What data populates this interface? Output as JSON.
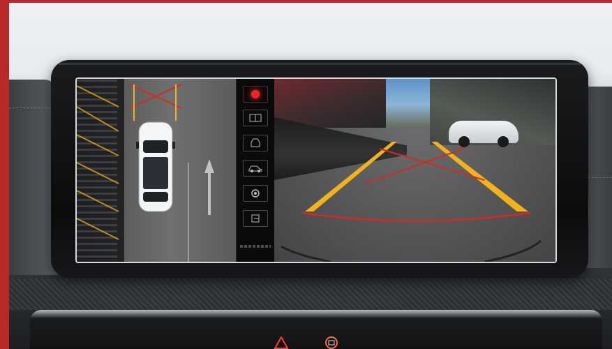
{
  "scene": {
    "frame_color": "#b8292c",
    "screen_border_color": "#d8dadd",
    "guide_yellow": "#f2b21c",
    "guide_red": "#d32b22"
  },
  "control_panel": {
    "buttons": [
      {
        "icon": "record-icon",
        "active": true
      },
      {
        "icon": "camera-view-icon"
      },
      {
        "icon": "car-front-icon"
      },
      {
        "icon": "car-side-icon"
      },
      {
        "icon": "settings-icon"
      },
      {
        "icon": "exit-icon"
      }
    ]
  },
  "views": {
    "left": "birds-eye-view",
    "right": "rear-camera-view"
  }
}
